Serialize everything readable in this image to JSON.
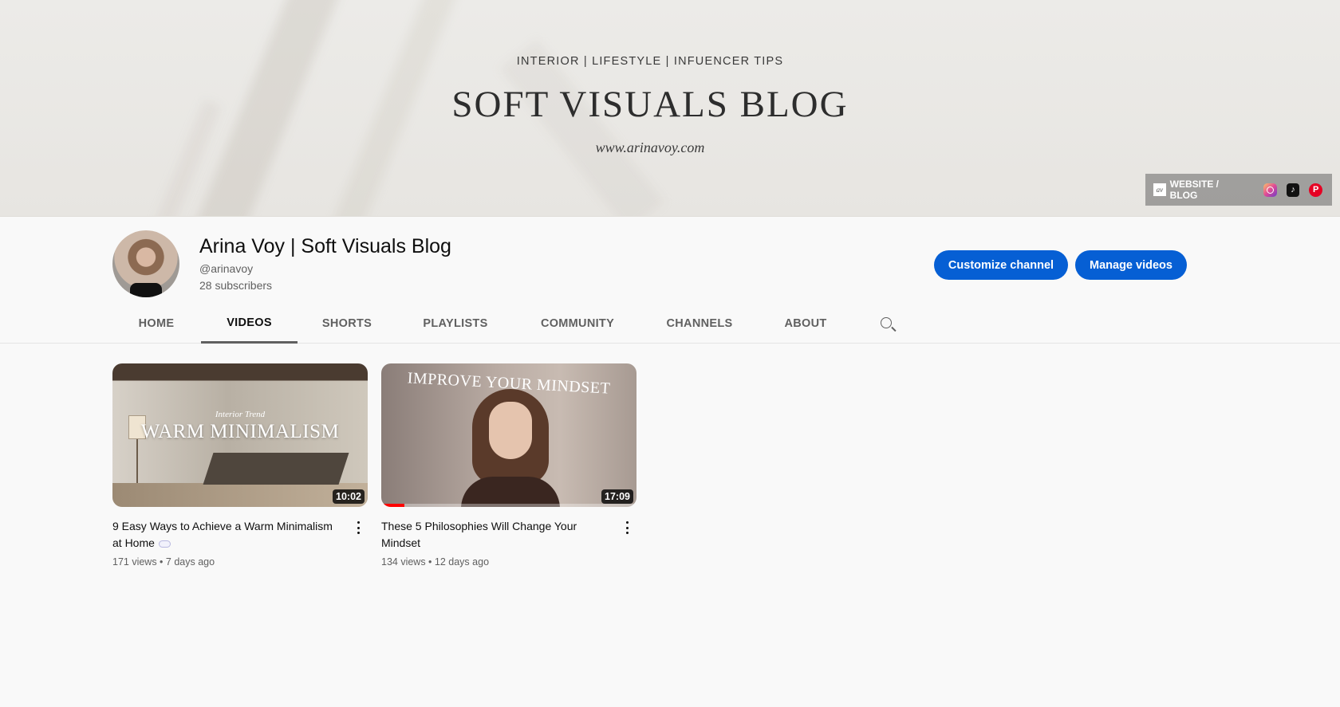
{
  "banner": {
    "tagline": "INTERIOR | LIFESTYLE | INFUENCER TIPS",
    "title": "SOFT VISUALS BLOG",
    "url": "www.arinavoy.com",
    "links": {
      "logo_text": "av",
      "website_label": "WEBSITE / BLOG",
      "icons": [
        "instagram-icon",
        "tiktok-icon",
        "pinterest-icon"
      ]
    }
  },
  "channel": {
    "name": "Arina Voy | Soft Visuals Blog",
    "handle": "@arinavoy",
    "subscribers": "28 subscribers",
    "buttons": {
      "customize": "Customize channel",
      "manage": "Manage videos"
    }
  },
  "tabs": [
    {
      "label": "HOME",
      "active": false
    },
    {
      "label": "VIDEOS",
      "active": true
    },
    {
      "label": "SHORTS",
      "active": false
    },
    {
      "label": "PLAYLISTS",
      "active": false
    },
    {
      "label": "COMMUNITY",
      "active": false
    },
    {
      "label": "CHANNELS",
      "active": false
    },
    {
      "label": "ABOUT",
      "active": false
    }
  ],
  "videos": [
    {
      "thumb_subtitle": "Interior Trend",
      "thumb_title": "WARM MINIMALISM",
      "duration": "10:02",
      "title": "9 Easy Ways to Achieve a Warm Minimalism at Home",
      "meta": "171 views • 7 days ago",
      "watched_fraction": 0
    },
    {
      "thumb_title": "IMPROVE YOUR MINDSET",
      "duration": "17:09",
      "title": "These 5 Philosophies Will Change Your Mindset",
      "meta": "134 views • 12 days ago",
      "watched_fraction": 0.09
    }
  ],
  "colors": {
    "accent_button": "#065fd4",
    "progress": "#ff0000"
  }
}
